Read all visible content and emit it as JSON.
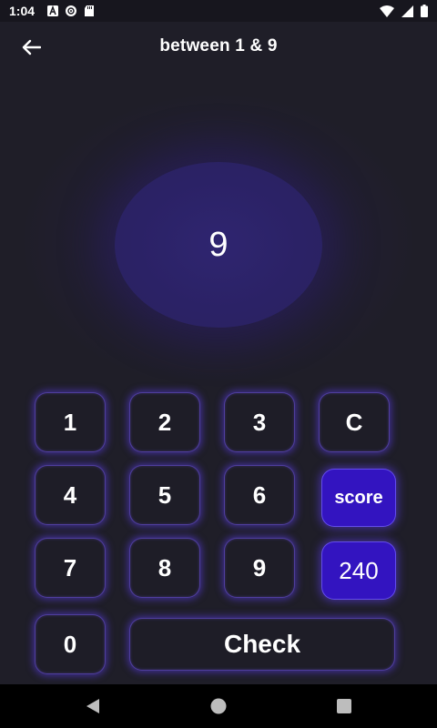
{
  "status_bar": {
    "time": "1:04",
    "icons": [
      "font-a-icon",
      "pocket-casts-icon",
      "sd-card-icon",
      "wifi-icon",
      "signal-icon",
      "battery-icon"
    ]
  },
  "header": {
    "title": "between 1 & 9",
    "back_icon": "arrow-left-icon"
  },
  "display": {
    "value": "9"
  },
  "keypad": {
    "keys": [
      "1",
      "2",
      "3",
      "C",
      "4",
      "5",
      "6",
      "7",
      "8",
      "9",
      "0"
    ],
    "check_label": "Check"
  },
  "score": {
    "label": "score",
    "value": "240"
  },
  "colors": {
    "background": "#1f1e28",
    "accent": "#3314c0",
    "glow": "#5a3ce6"
  },
  "nav_bar": {
    "icons": [
      "back-triangle-icon",
      "home-circle-icon",
      "recents-square-icon"
    ]
  }
}
